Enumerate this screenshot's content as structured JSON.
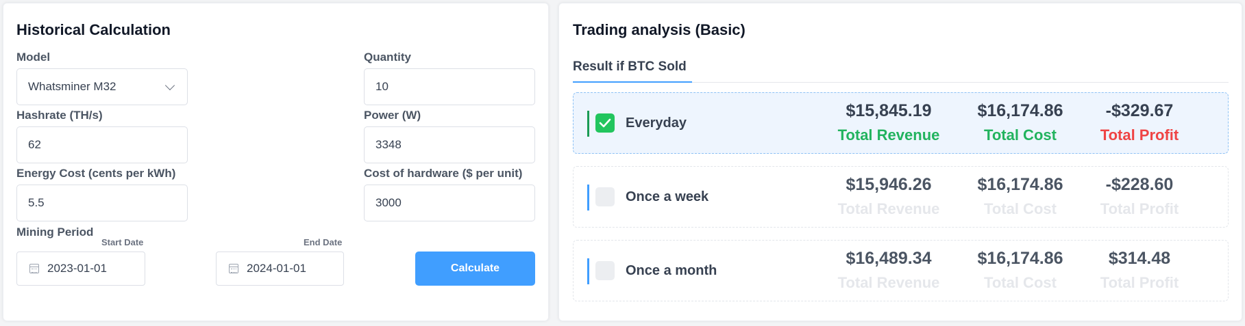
{
  "historical": {
    "title": "Historical Calculation",
    "model": {
      "label": "Model",
      "value": "Whatsminer M32"
    },
    "quantity": {
      "label": "Quantity",
      "value": "10"
    },
    "hashrate": {
      "label": "Hashrate (TH/s)",
      "value": "62"
    },
    "power": {
      "label": "Power (W)",
      "value": "3348"
    },
    "energy_cost": {
      "label": "Energy Cost (cents per kWh)",
      "value": "5.5"
    },
    "hardware_cost": {
      "label": "Cost of hardware ($ per unit)",
      "value": "3000"
    },
    "mining_period": {
      "label": "Mining Period",
      "start_label": "Start Date",
      "start_value": "2023-01-01",
      "end_label": "End Date",
      "end_value": "2024-01-01"
    },
    "calculate_label": "Calculate"
  },
  "trading": {
    "title": "Trading analysis (Basic)",
    "tab_label": "Result if BTC Sold",
    "options": [
      {
        "label": "Everyday",
        "checked": true,
        "revenue": "$15,845.19",
        "cost": "$16,174.86",
        "profit": "-$329.67",
        "revenue_caption": "Total Revenue",
        "cost_caption": "Total Cost",
        "profit_caption": "Total Profit"
      },
      {
        "label": "Once a week",
        "checked": false,
        "revenue": "$15,946.26",
        "cost": "$16,174.86",
        "profit": "-$228.60",
        "revenue_caption": "Total Revenue",
        "cost_caption": "Total Cost",
        "profit_caption": "Total Profit"
      },
      {
        "label": "Once a month",
        "checked": false,
        "revenue": "$16,489.34",
        "cost": "$16,174.86",
        "profit": "$314.48",
        "revenue_caption": "Total Revenue",
        "cost_caption": "Total Cost",
        "profit_caption": "Total Profit"
      }
    ]
  },
  "colors": {
    "accent": "#409eff",
    "positive": "#22b35e",
    "negative": "#ef4444"
  },
  "icons": {
    "model_select": "chevron-down-icon",
    "date": "calendar-icon",
    "checkbox": "check-icon"
  }
}
